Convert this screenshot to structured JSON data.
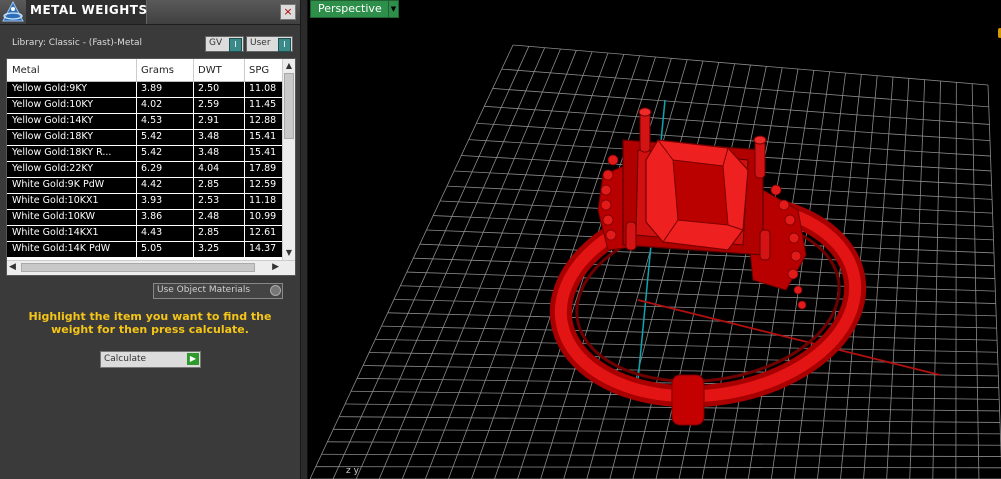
{
  "panel": {
    "title": "METAL WEIGHTS",
    "close_label": "×",
    "library_label": "Library: Classic - (Fast)-Metal",
    "gv_label": "GV",
    "user_label": "User",
    "toggle_knob": "I",
    "use_object_materials_label": "Use Object Materials",
    "instructions": "Highlight the item you want to find the weight for then press calculate.",
    "calculate_label": "Calculate"
  },
  "table": {
    "columns": [
      "Metal",
      "Grams",
      "DWT",
      "SPG"
    ],
    "rows": [
      {
        "metal": "Yellow Gold:9KY",
        "grams": "3.89",
        "dwt": "2.50",
        "spg": "11.08"
      },
      {
        "metal": "Yellow Gold:10KY",
        "grams": "4.02",
        "dwt": "2.59",
        "spg": "11.45"
      },
      {
        "metal": "Yellow Gold:14KY",
        "grams": "4.53",
        "dwt": "2.91",
        "spg": "12.88"
      },
      {
        "metal": "Yellow Gold:18KY",
        "grams": "5.42",
        "dwt": "3.48",
        "spg": "15.41"
      },
      {
        "metal": "Yellow Gold:18KY R...",
        "grams": "5.42",
        "dwt": "3.48",
        "spg": "15.41"
      },
      {
        "metal": "Yellow Gold:22KY",
        "grams": "6.29",
        "dwt": "4.04",
        "spg": "17.89"
      },
      {
        "metal": "White Gold:9K PdW",
        "grams": "4.42",
        "dwt": "2.85",
        "spg": "12.59"
      },
      {
        "metal": "White Gold:10KX1",
        "grams": "3.93",
        "dwt": "2.53",
        "spg": "11.18"
      },
      {
        "metal": "White Gold:10KW",
        "grams": "3.86",
        "dwt": "2.48",
        "spg": "10.99"
      },
      {
        "metal": "White Gold:14KX1",
        "grams": "4.43",
        "dwt": "2.85",
        "spg": "12.61"
      },
      {
        "metal": "White Gold:14K PdW",
        "grams": "5.05",
        "dwt": "3.25",
        "spg": "14.37"
      }
    ],
    "scroll_up": "▲",
    "scroll_down": "▼",
    "scroll_left": "◀",
    "scroll_right": "▶"
  },
  "viewport": {
    "view_name": "Perspective",
    "dropdown_icon": "▼",
    "axis_label": "z y",
    "model": "ring",
    "model_color": "#cc0000",
    "grid_color": "#8a8a8a",
    "x_axis_color": "#b01010",
    "y_axis_color": "#0fa5b0"
  },
  "icons": {
    "logo": "app-logo-icon",
    "close": "close-icon",
    "calculate_arrow": "play-arrow-icon"
  }
}
